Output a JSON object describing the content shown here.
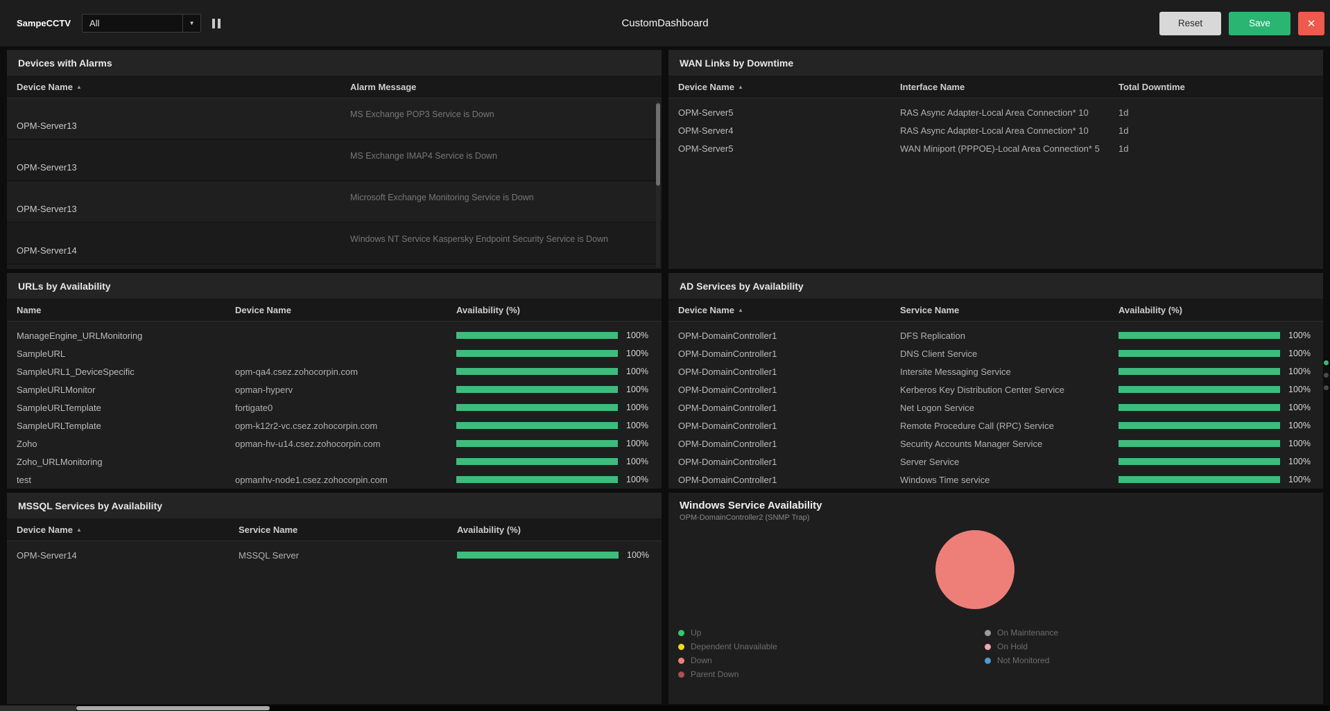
{
  "icons": {
    "sort_asc": "▲",
    "dropdown": "▼",
    "close": "✕"
  },
  "topbar": {
    "app_label": "SampeCCTV",
    "filter_value": "All",
    "title": "CustomDashboard",
    "reset_label": "Reset",
    "save_label": "Save"
  },
  "colors": {
    "bar_green": "#3dbd7d",
    "save_green": "#2bb573",
    "close_red": "#ef5a4c",
    "pie_down": "#ee7f78"
  },
  "panels": {
    "alarms": {
      "title": "Devices with Alarms",
      "columns": [
        "Device Name",
        "Alarm Message"
      ],
      "rows": [
        {
          "device": "OPM-Server13",
          "message": "MS Exchange POP3 Service is Down"
        },
        {
          "device": "OPM-Server13",
          "message": "MS Exchange IMAP4 Service is Down"
        },
        {
          "device": "OPM-Server13",
          "message": "Microsoft Exchange Monitoring Service is Down"
        },
        {
          "device": "OPM-Server14",
          "message": "Windows NT Service Kaspersky Endpoint Security Service is Down"
        }
      ]
    },
    "wan": {
      "title": "WAN Links by Downtime",
      "columns": [
        "Device Name",
        "Interface Name",
        "Total Downtime"
      ],
      "rows": [
        {
          "device": "OPM-Server5",
          "interface": "RAS Async Adapter-Local Area Connection* 10",
          "downtime": "1d"
        },
        {
          "device": "OPM-Server4",
          "interface": "RAS Async Adapter-Local Area Connection* 10",
          "downtime": "1d"
        },
        {
          "device": "OPM-Server5",
          "interface": "WAN Miniport (PPPOE)-Local Area Connection* 5",
          "downtime": "1d"
        }
      ]
    },
    "urls": {
      "title": "URLs by Availability",
      "columns": [
        "Name",
        "Device Name",
        "Availability (%)"
      ],
      "rows": [
        {
          "name": "ManageEngine_URLMonitoring",
          "device": "",
          "pct": 100,
          "availability": "100%"
        },
        {
          "name": "SampleURL",
          "device": "",
          "pct": 100,
          "availability": "100%"
        },
        {
          "name": "SampleURL1_DeviceSpecific",
          "device": "opm-qa4.csez.zohocorpin.com",
          "pct": 100,
          "availability": "100%"
        },
        {
          "name": "SampleURLMonitor",
          "device": "opman-hyperv",
          "pct": 100,
          "availability": "100%"
        },
        {
          "name": "SampleURLTemplate",
          "device": "fortigate0",
          "pct": 100,
          "availability": "100%"
        },
        {
          "name": "SampleURLTemplate",
          "device": "opm-k12r2-vc.csez.zohocorpin.com",
          "pct": 100,
          "availability": "100%"
        },
        {
          "name": "Zoho",
          "device": "opman-hv-u14.csez.zohocorpin.com",
          "pct": 100,
          "availability": "100%"
        },
        {
          "name": "Zoho_URLMonitoring",
          "device": "",
          "pct": 100,
          "availability": "100%"
        },
        {
          "name": "test",
          "device": "opmanhv-node1.csez.zohocorpin.com",
          "pct": 100,
          "availability": "100%"
        }
      ]
    },
    "ad": {
      "title": "AD Services by Availability",
      "columns": [
        "Device Name",
        "Service Name",
        "Availability (%)"
      ],
      "rows": [
        {
          "device": "OPM-DomainController1",
          "service": "DFS Replication",
          "pct": 100,
          "availability": "100%"
        },
        {
          "device": "OPM-DomainController1",
          "service": "DNS Client Service",
          "pct": 100,
          "availability": "100%"
        },
        {
          "device": "OPM-DomainController1",
          "service": "Intersite Messaging Service",
          "pct": 100,
          "availability": "100%"
        },
        {
          "device": "OPM-DomainController1",
          "service": "Kerberos Key Distribution Center Service",
          "pct": 100,
          "availability": "100%"
        },
        {
          "device": "OPM-DomainController1",
          "service": "Net Logon Service",
          "pct": 100,
          "availability": "100%"
        },
        {
          "device": "OPM-DomainController1",
          "service": "Remote Procedure Call (RPC) Service",
          "pct": 100,
          "availability": "100%"
        },
        {
          "device": "OPM-DomainController1",
          "service": "Security Accounts Manager Service",
          "pct": 100,
          "availability": "100%"
        },
        {
          "device": "OPM-DomainController1",
          "service": "Server Service",
          "pct": 100,
          "availability": "100%"
        },
        {
          "device": "OPM-DomainController1",
          "service": "Windows Time service",
          "pct": 100,
          "availability": "100%"
        }
      ]
    },
    "mssql": {
      "title": "MSSQL Services by Availability",
      "columns": [
        "Device Name",
        "Service Name",
        "Availability (%)"
      ],
      "rows": [
        {
          "device": "OPM-Server14",
          "service": "MSSQL Server",
          "pct": 100,
          "availability": "100%"
        }
      ]
    },
    "windows_service": {
      "title": "Windows Service Availability",
      "subtitle": "OPM-DomainController2 (SNMP Trap)",
      "chart_data": {
        "type": "pie",
        "title": "Windows Service Availability",
        "subtitle": "OPM-DomainController2 (SNMP Trap)",
        "slices": [
          {
            "label": "Down",
            "value": 100,
            "color": "#ee7f78"
          }
        ],
        "legend": [
          {
            "label": "Up",
            "color": "#2ecc71"
          },
          {
            "label": "Dependent Unavailable",
            "color": "#f0d81c"
          },
          {
            "label": "Down",
            "color": "#ee7f78"
          },
          {
            "label": "Parent Down",
            "color": "#a8534e"
          },
          {
            "label": "On Maintenance",
            "color": "#9b9b9b"
          },
          {
            "label": "On Hold",
            "color": "#f3a5b2"
          },
          {
            "label": "Not Monitored",
            "color": "#4d9bd8"
          }
        ],
        "legend_position": "bottom"
      }
    }
  }
}
